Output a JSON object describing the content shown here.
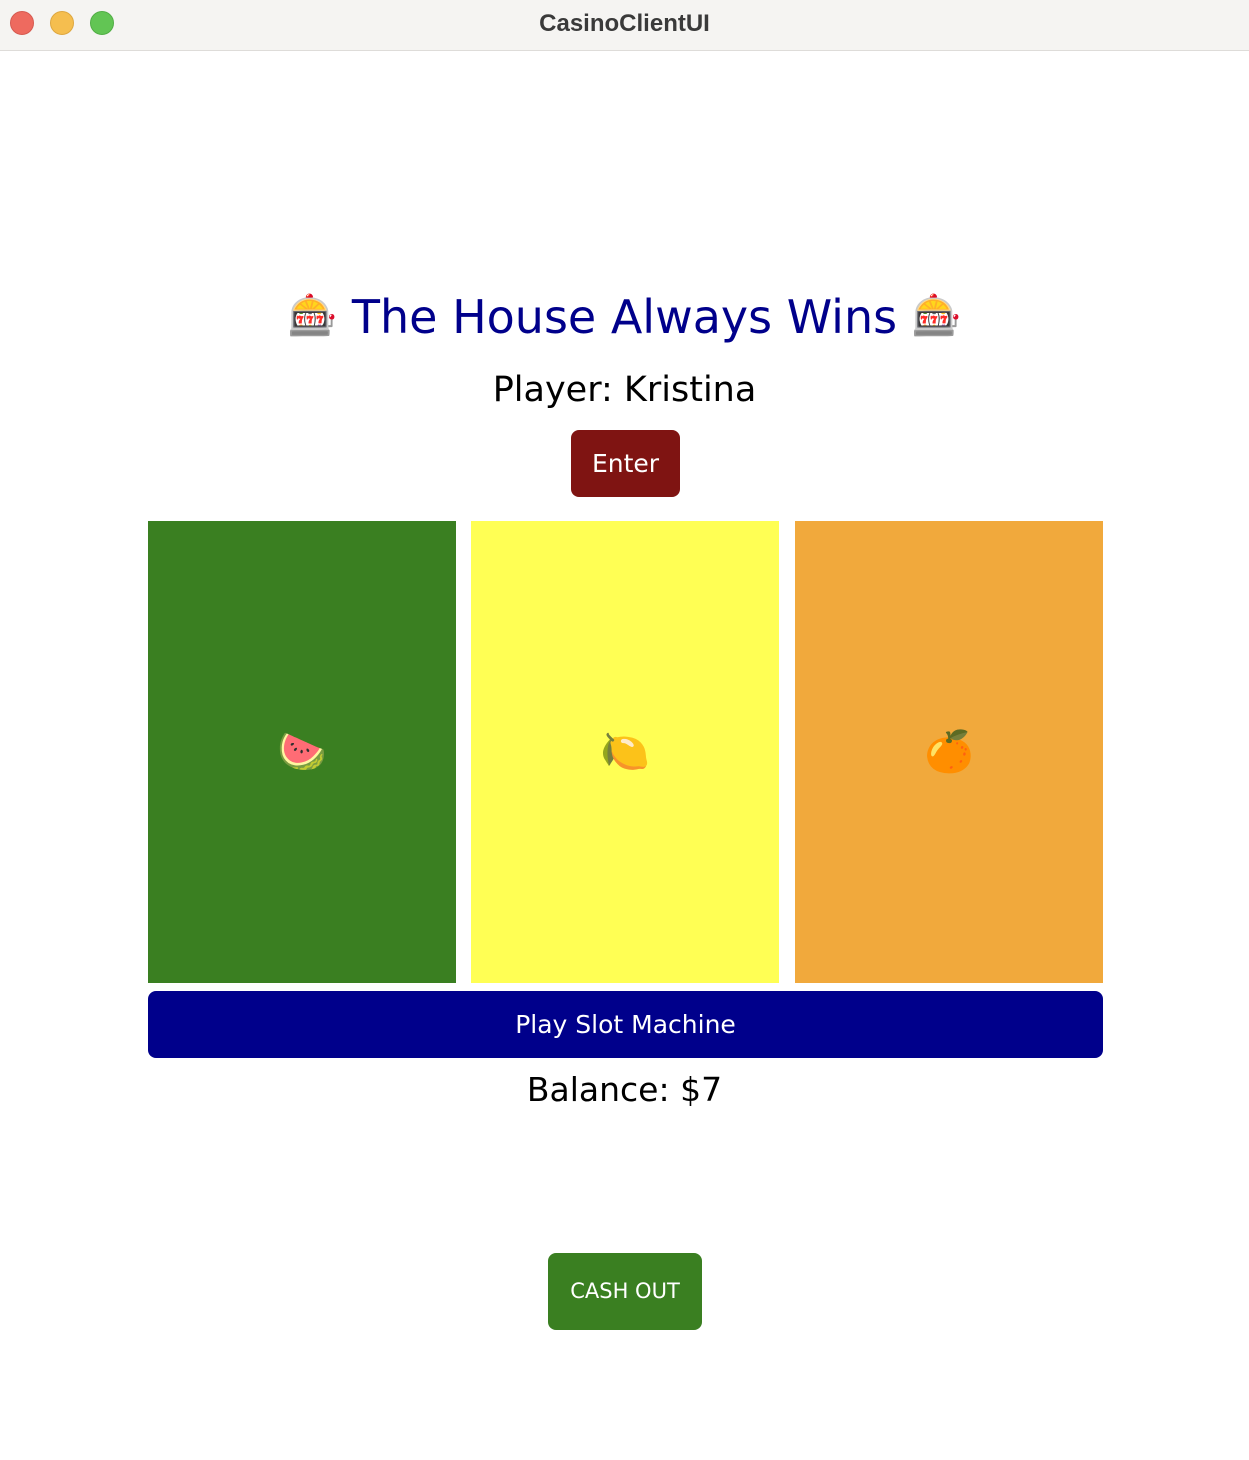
{
  "window": {
    "title": "CasinoClientUI"
  },
  "header": {
    "title": "The House Always Wins",
    "emoji_left": "🎰",
    "emoji_right": "🎰"
  },
  "player": {
    "label": "Player:",
    "name": "Kristina"
  },
  "enter_button": {
    "label": "Enter"
  },
  "reels": [
    {
      "symbol": "🍉",
      "symbol_name": "watermelon",
      "color": "#3a7f21"
    },
    {
      "symbol": "🍋",
      "symbol_name": "lemon",
      "color": "#ffff54"
    },
    {
      "symbol": "🍊",
      "symbol_name": "orange",
      "color": "#f1a93c"
    }
  ],
  "play_button": {
    "label": "Play Slot Machine"
  },
  "balance": {
    "label": "Balance:",
    "value": "$7"
  },
  "cashout_button": {
    "label": "CASH OUT"
  },
  "colors": {
    "title": "#00008b",
    "enter_button": "#7f1412",
    "play_button": "#00008b",
    "cashout_button": "#3a7f21"
  }
}
